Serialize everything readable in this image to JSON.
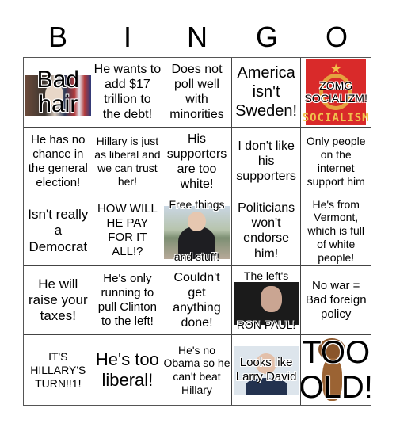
{
  "header": {
    "letters": [
      "B",
      "I",
      "N",
      "G",
      "O"
    ]
  },
  "cells": [
    {
      "text": "Bad hair",
      "image": "bernie-sanders-photo"
    },
    {
      "text": "He wants to add $17 trillion to the debt!"
    },
    {
      "text": "Does not poll well with minorities"
    },
    {
      "text": "America isn't Sweden!"
    },
    {
      "text": "ZOMG SOCIALIZM!",
      "image": "socialism-poster",
      "image_caption": "SOCIALISM"
    },
    {
      "text": "He has no chance in the general election!"
    },
    {
      "text": "Hillary is just as liberal and we can trust her!"
    },
    {
      "text": "His supporters are too white!"
    },
    {
      "text": "I don't like his supporters"
    },
    {
      "text": "Only people on the internet support him"
    },
    {
      "text": "Isn't really a Democrat"
    },
    {
      "text": "HOW WILL HE PAY FOR IT ALL!?"
    },
    {
      "text_top": "Free things",
      "text_bottom": "and stuff!",
      "image": "bernie-sanders-smiling-photo"
    },
    {
      "text": "Politicians won't endorse him!"
    },
    {
      "text": "He's from Vermont, which is full of white people!"
    },
    {
      "text": "He will raise your taxes!"
    },
    {
      "text": "He's only running to pull Clinton to the left!"
    },
    {
      "text": "Couldn't get anything done!"
    },
    {
      "text_top": "The left's",
      "text_bottom": "RON PAUL!",
      "image": "ron-paul-photo"
    },
    {
      "text": "No war = Bad foreign policy"
    },
    {
      "text": "IT'S HILLARY'S TURN!!1!"
    },
    {
      "text": "He's too liberal!"
    },
    {
      "text": "He's no Obama so he can't beat Hillary"
    },
    {
      "text": "Looks like Larry David",
      "image": "larry-david-photo"
    },
    {
      "text": "TOO OLD!",
      "image": "cartoon-bear"
    }
  ]
}
